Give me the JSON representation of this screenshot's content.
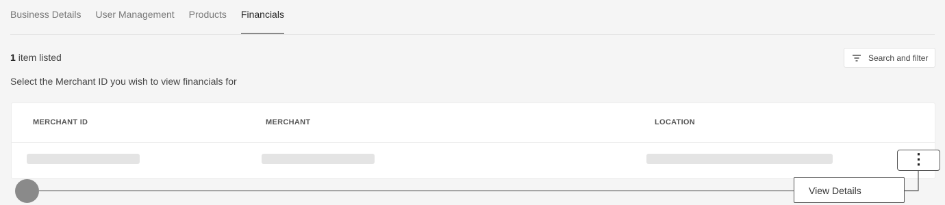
{
  "tabs": [
    {
      "label": "Business Details",
      "active": false
    },
    {
      "label": "User Management",
      "active": false
    },
    {
      "label": "Products",
      "active": false
    },
    {
      "label": "Financials",
      "active": true
    }
  ],
  "listing": {
    "count": "1",
    "count_suffix": "item listed"
  },
  "filter": {
    "label": "Search and filter",
    "icon": "filter-icon"
  },
  "instruction": "Select the Merchant ID you wish to view financials for",
  "table": {
    "columns": [
      "MERCHANT ID",
      "MERCHANT",
      "LOCATION"
    ],
    "rows": [
      {
        "cells": [
          "",
          "",
          ""
        ],
        "loading": true
      }
    ]
  },
  "row_actions": {
    "icon": "more-vertical-icon",
    "menu_items": [
      "View Details"
    ]
  },
  "colors": {
    "accent": "#888888",
    "skeleton": "#e4e4e4",
    "background": "#f5f5f5"
  }
}
